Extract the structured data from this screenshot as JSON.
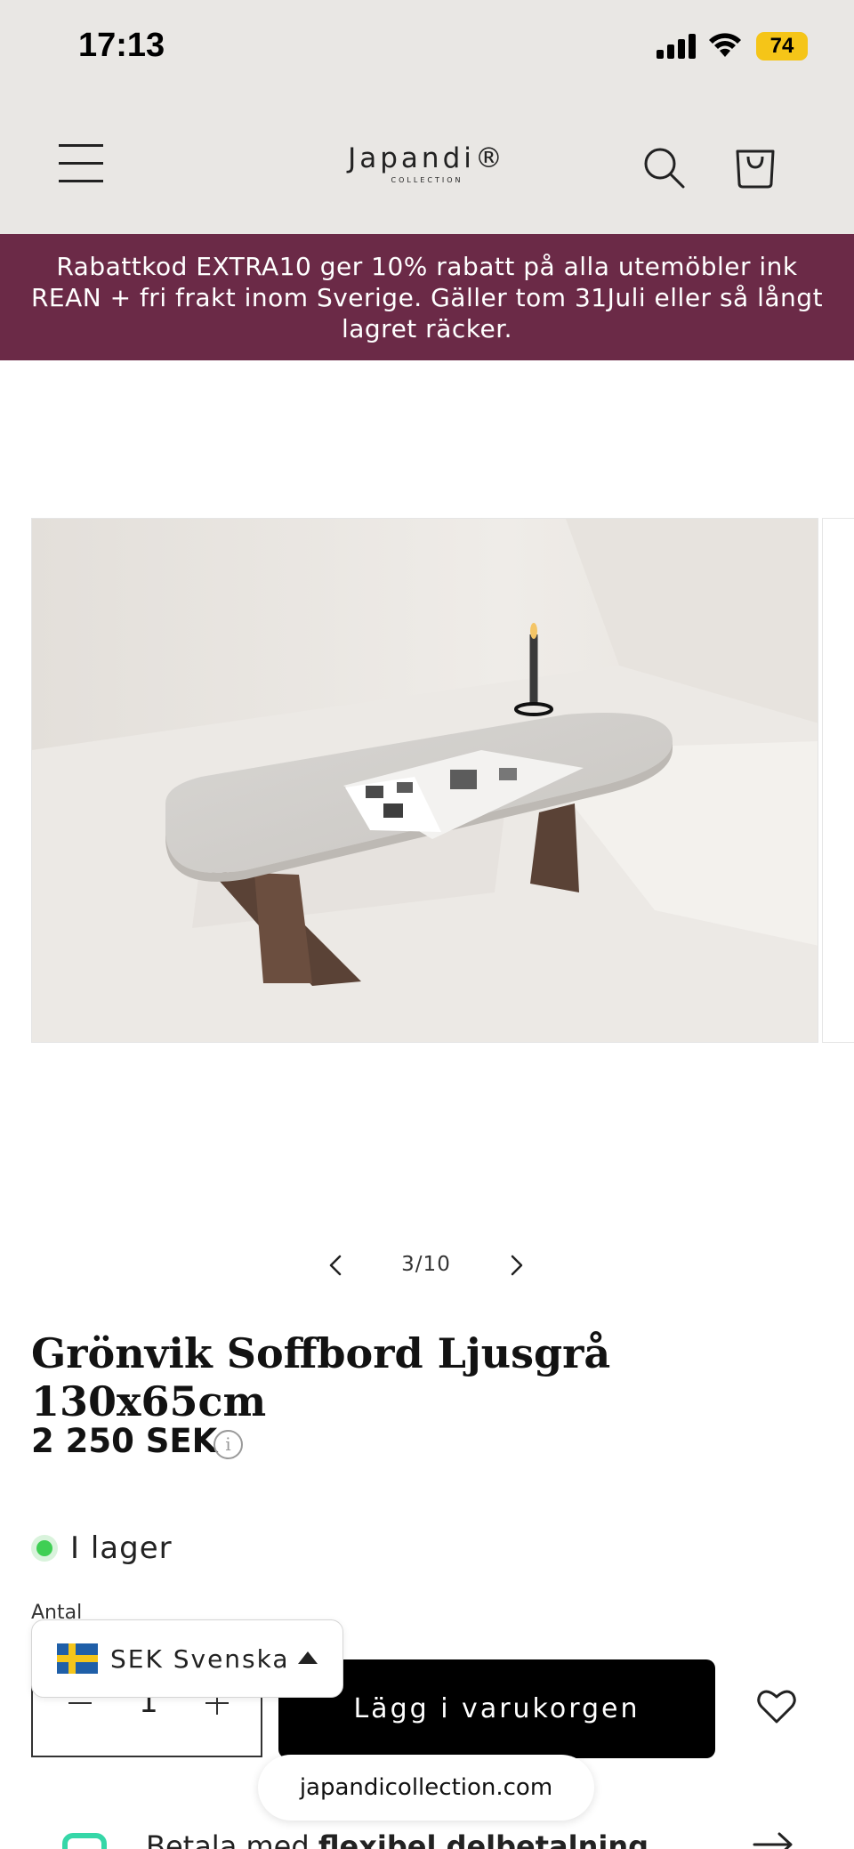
{
  "status_bar": {
    "time": "17:13",
    "battery": "74"
  },
  "header": {
    "logo_main": "Japandi®",
    "logo_sub": "COLLECTION"
  },
  "announcement": {
    "text": "Rabattkod EXTRA10 ger 10% rabatt på alla utemöbler ink REAN + fri frakt inom Sverige. Gäller tom 31Juli eller så långt lagret räcker."
  },
  "gallery": {
    "counter": "3/10"
  },
  "product": {
    "title": "Grönvik Soffbord Ljusgrå 130x65cm",
    "price": "2 250 SEK",
    "price_info_icon": "i",
    "stock_status": "I lager",
    "quantity_label": "Antal",
    "quantity_value": "1",
    "add_to_cart_label": "Lägg i varukorgen"
  },
  "currency_selector": {
    "label": "SEK Svenska"
  },
  "browser": {
    "domain": "japandicollection.com"
  },
  "payment": {
    "prefix": "Betala med",
    "bold": "flexibel delbetalning"
  },
  "colors": {
    "announcement_bg": "#6b2a47",
    "header_bg": "#e9e7e4",
    "stock_green": "#3fcf54",
    "battery_yellow": "#f5c518"
  },
  "icons": [
    "hamburger-menu-icon",
    "search-icon",
    "cart-bag-icon",
    "chevron-left-icon",
    "chevron-right-icon",
    "info-icon",
    "heart-icon",
    "sweden-flag-icon",
    "caret-up-icon",
    "arrow-right-icon",
    "signal-icon",
    "wifi-icon",
    "battery-icon"
  ]
}
